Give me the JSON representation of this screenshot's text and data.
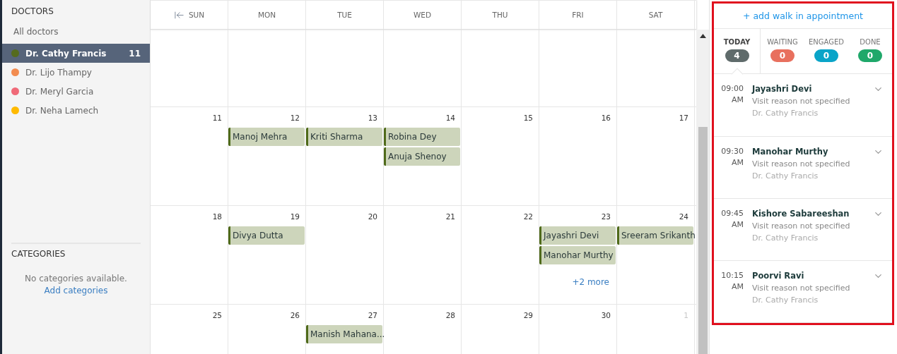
{
  "sidebar": {
    "doctors_heading": "DOCTORS",
    "all_doctors": "All doctors",
    "doctors": [
      {
        "name": "Dr. Cathy Francis",
        "count": "11",
        "color": "#556b1e",
        "selected": true
      },
      {
        "name": "Dr. Lijo Thampy",
        "color": "#f28c50",
        "selected": false
      },
      {
        "name": "Dr. Meryl Garcia",
        "color": "#f06a78",
        "selected": false
      },
      {
        "name": "Dr. Neha Lamech",
        "color": "#ffba00",
        "selected": false
      }
    ],
    "categories_heading": "CATEGORIES",
    "categories_empty": "No categories available.",
    "add_categories": "Add categories"
  },
  "calendar": {
    "weekdays": [
      "SUN",
      "MON",
      "TUE",
      "WED",
      "THU",
      "FRI",
      "SAT"
    ],
    "weeks": [
      [
        {
          "day": "11",
          "muted": false
        },
        {
          "day": "12",
          "muted": false,
          "events": [
            "Manoj Mehra"
          ]
        },
        {
          "day": "13",
          "muted": false,
          "events": [
            "Kriti Sharma"
          ]
        },
        {
          "day": "14",
          "muted": false,
          "events": [
            "Robina Dey",
            "Anuja Shenoy"
          ]
        },
        {
          "day": "15",
          "muted": false
        },
        {
          "day": "16",
          "muted": false
        },
        {
          "day": "17",
          "muted": false
        }
      ],
      [
        {
          "day": "18",
          "muted": false
        },
        {
          "day": "19",
          "muted": false,
          "events": [
            "Divya Dutta"
          ]
        },
        {
          "day": "20",
          "muted": false
        },
        {
          "day": "21",
          "muted": false
        },
        {
          "day": "22",
          "muted": false
        },
        {
          "day": "23",
          "muted": false,
          "events": [
            "Jayashri Devi",
            "Manohar Murthy"
          ],
          "more": "+2 more"
        },
        {
          "day": "24",
          "muted": false,
          "events": [
            "Sreeram Srikanth"
          ]
        }
      ],
      [
        {
          "day": "25",
          "muted": false
        },
        {
          "day": "26",
          "muted": false
        },
        {
          "day": "27",
          "muted": false,
          "events": [
            "Manish Mahana..."
          ]
        },
        {
          "day": "28",
          "muted": false
        },
        {
          "day": "29",
          "muted": false
        },
        {
          "day": "30",
          "muted": false
        },
        {
          "day": "1",
          "muted": true
        }
      ]
    ]
  },
  "panel": {
    "add_walk_in": "+ add walk in appointment",
    "stats": [
      {
        "label": "TODAY",
        "count": "4",
        "color": "#5f6b6b",
        "selected": true
      },
      {
        "label": "WAITING",
        "count": "0",
        "color": "#e8705e",
        "selected": false
      },
      {
        "label": "ENGAGED",
        "count": "0",
        "color": "#0aa4c8",
        "selected": false
      },
      {
        "label": "DONE",
        "count": "0",
        "color": "#1fa86a",
        "selected": false
      }
    ],
    "appointments": [
      {
        "time": "09:00",
        "period": "AM",
        "patient": "Jayashri Devi",
        "reason": "Visit reason not specified",
        "doctor": "Dr. Cathy Francis"
      },
      {
        "time": "09:30",
        "period": "AM",
        "patient": "Manohar Murthy",
        "reason": "Visit reason not specified",
        "doctor": "Dr. Cathy Francis"
      },
      {
        "time": "09:45",
        "period": "AM",
        "patient": "Kishore Sabareeshan",
        "reason": "Visit reason not specified",
        "doctor": "Dr. Cathy Francis"
      },
      {
        "time": "10:15",
        "period": "AM",
        "patient": "Poorvi Ravi",
        "reason": "Visit reason not specified",
        "doctor": "Dr. Cathy Francis"
      }
    ]
  }
}
